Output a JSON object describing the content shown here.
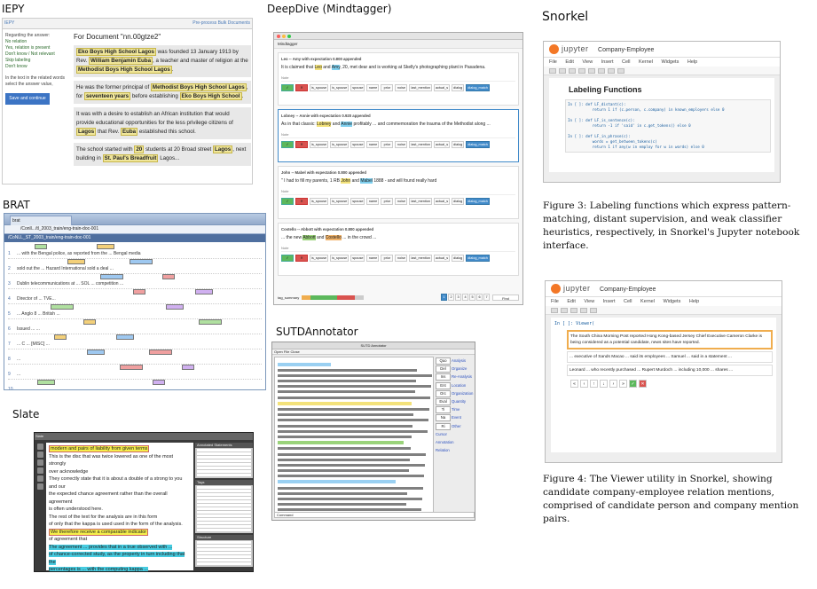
{
  "labels": {
    "iepy": "IEPY",
    "deepdive": "DeepDive (Mindtagger)",
    "snorkel": "Snorkel",
    "brat": "BRAT",
    "sutd": "SUTDAnnotator",
    "slate": "Slate"
  },
  "iepy": {
    "nav_left": "IEPY",
    "nav_right": "Pre-process Bulk  Documents",
    "side_question": "Regarding the answer:",
    "side_options": [
      "No relation",
      "Yes, relation is present",
      "Don't know / Not relevant",
      "Skip labeling",
      "Don't know"
    ],
    "side_note": "In the text in the related words select the answer value,",
    "side_button": "Save and continue",
    "doc_title": "For Document \"nn.00gtze2\"",
    "para1": [
      "Eko Boys High School Lagos",
      " was founded 13 January 1913 by Rev. ",
      "William Benjamin Euba",
      ", a teacher and master of religion at the ",
      "Methodist Boys High School Lagos",
      "."
    ],
    "para2": [
      "He was the former principal of ",
      "Methodist Boys High School Lagos",
      ", for ",
      "seventeen years",
      " before establishing ",
      "Eko Boys High School",
      "."
    ],
    "para3": [
      "It was with a desire to establish an African institution that would provide educational opportunities for the less privilege citizens of ",
      "Lagos",
      " that Rev. ",
      "Euba",
      " established this school."
    ],
    "para4": [
      "The school started with ",
      "20",
      " students at 20 Broad street ",
      "Lagos",
      ", next building in ",
      "St. Paul's Breadfruit",
      " Lagos..."
    ]
  },
  "brat": {
    "tab": "brat",
    "url": "/Conll.../tl_2003_train/eng-train-doc-001",
    "bar": "/CoNLL_ST_2003_train/eng-train-doc-001",
    "rows": [
      {
        "n": "1",
        "text": "... with the Bengal police, as reported from the ... Bengal media"
      },
      {
        "n": "2",
        "text": "sold out the ... Hazard International sold a deal ..."
      },
      {
        "n": "3",
        "text": "Dublin telecommunications at ... SOL ... competition ... "
      },
      {
        "n": "4",
        "text": "Director of ... TVE..."
      },
      {
        "n": "5",
        "text": "... Anglo 8 ... British ..."
      },
      {
        "n": "6",
        "text": "Issued ... ..."
      },
      {
        "n": "7",
        "text": "... C ... [MISC] ..."
      },
      {
        "n": "8",
        "text": "..."
      },
      {
        "n": "9",
        "text": "..."
      },
      {
        "n": "10",
        "text": "..."
      }
    ]
  },
  "slate": {
    "title": "Slate",
    "lines": [
      {
        "text": "modern and pairs of liability from given terms",
        "style": "y"
      },
      {
        "text": "This is the disc that was twice lowered as one of the most strongly",
        "style": ""
      },
      {
        "text": "over acknowledge",
        "style": ""
      },
      {
        "text": "They correctly state that it is about a double of a strong to you and our",
        "style": ""
      },
      {
        "text": "the expected chance agreement rather than the overall agreement",
        "style": ""
      },
      {
        "text": "is often understood here.",
        "style": ""
      },
      {
        "text": "The rest of the text for the analysis are in this form",
        "style": ""
      },
      {
        "text": "of only that the kappa is used used in the form of the analysis.",
        "style": ""
      },
      {
        "text": "We therefore receive a comparable indicator",
        "style": "y"
      },
      {
        "text": "of agreement that",
        "style": ""
      },
      {
        "text": "The agreement ... provides that in a true observed with ... ",
        "style": "c"
      },
      {
        "text": "of chance-corrected study, as the property in turn including that the",
        "style": "c"
      },
      {
        "text": "percentages is ... with the computing kappa ...",
        "style": "c"
      },
      {
        "text": "instead they are percentage agreement to arrive at the conclusion.",
        "style": "y"
      },
      {
        "text": "By correcting the case, it is clear that the conclusion can be fake.",
        "style": ""
      },
      {
        "text": "In a special for ... analysis kappa of ... 1.0 stand between ...",
        "style": ""
      }
    ],
    "right_panels": [
      "Annotated Statements",
      "Tags",
      "Structure"
    ]
  },
  "deepdive": {
    "toolbar": "Mindtagger",
    "cards": [
      {
        "label": "Leo -- Amy with expectation 0.800 appended",
        "sent": [
          "It is claimed that ",
          "Leo",
          " and ",
          "Amy",
          ", 20, met dear and is working at Skelly's photographing plant in Pasadena."
        ],
        "hl": [
          "y",
          "b"
        ],
        "field": "Note",
        "selected": false
      },
      {
        "label": "Lobney -- Annie with expectation 0.920 appended",
        "sent": [
          "As in that classic: ",
          "Lobney",
          " and ",
          "Annie",
          " profitably ... and commemoration the trauma of the Methodist along ... "
        ],
        "hl": [
          "y",
          "b"
        ],
        "field": "Note",
        "selected": true
      },
      {
        "label": "John -- Mabel with expectation 0.800 appended",
        "sent": [
          "\" I had to fill my parents, 1 RB ",
          "John",
          " and ",
          "Mabel",
          " 1888 - and will found really hard"
        ],
        "hl": [
          "y",
          "b"
        ],
        "field": "Note",
        "selected": false
      },
      {
        "label": "Costello -- Abbott with expectation 0.800 appended",
        "sent": [
          "... the new ",
          "Abbott",
          " and ",
          "Costello",
          " ... in the crowd ..."
        ],
        "hl": [
          "g",
          "o"
        ],
        "field": "Note",
        "selected": false
      }
    ],
    "tags": [
      "is_spouse",
      "is_spouse",
      "spouse",
      "name",
      "prior",
      "noise",
      "last_mention",
      "actual_s",
      "dialog",
      "dialog_match"
    ],
    "footer_left": "tag_summary",
    "footer_pages": [
      "1",
      "2",
      "3",
      "4",
      "5",
      "6",
      "7"
    ],
    "footer_search": "Find"
  },
  "sutd": {
    "title": "SUTD Annotator",
    "menu": "Open  File  Close",
    "side": [
      {
        "k": "Quo",
        "v": "Analysis"
      },
      {
        "k": "Del",
        "v": "Organize"
      },
      {
        "k": "Ins",
        "v": "Re-Analysis"
      },
      {
        "k": "Ent",
        "v": "Location"
      },
      {
        "k": "Orc",
        "v": "Organization"
      },
      {
        "k": "Eval",
        "v": "Quantity"
      },
      {
        "k": "Ti",
        "v": "Time"
      },
      {
        "k": "Na",
        "v": "Event"
      },
      {
        "k": "Ri",
        "v": "Other"
      }
    ],
    "side_notes": [
      "Cursor",
      "Annotation",
      "Relation"
    ],
    "bottom": "Command"
  },
  "snorkel1": {
    "jupyter": "jupyter",
    "nbname": "Company-Employee",
    "menu": "File Edit View Insert Cell Kernel Widgets Help",
    "heading": "Labeling Functions",
    "code": [
      "In [ ]: def LF_distant(c):",
      "           return 1 if (c.person, c.company) in known_employers else 0",
      "",
      "In [ ]: def LF_is_sentence(c):",
      "           return -1 if 'said' in c.get_tokens() else 0",
      "",
      "In [ ]: def LF_in_phrase(c):",
      "           words = get_between_tokens(c)",
      "           return 1 if any(w in employ for w in words) else 0"
    ]
  },
  "caption3": "Figure 3: Labeling functions which express pattern-matching, distant supervision, and weak classifier heuristics, respectively, in Snorkel's Jupyter notebook interface.",
  "snorkel2": {
    "jupyter": "jupyter",
    "nbname": "Company-Employee",
    "menu": "File Edit View Insert Cell Kernel Widgets Help",
    "cell": "In [ ]: Viewer(",
    "rows": [
      "The South China Morning Post reported Hong Kong-based Jersey Chief Executive Cameron Clarke is being considered as a potential candidate, news sites have reported.",
      "... executive of Sands Macao ... said its employees ... Samuel ... said in a statement ...",
      "Leonard ... who recently purchased ... Rupert Murdoch ... including 10,000 ... shares ..."
    ]
  },
  "caption4": "Figure 4: The Viewer utility in Snorkel, showing candidate company-employee relation mentions, comprised of candidate person and company mention pairs."
}
